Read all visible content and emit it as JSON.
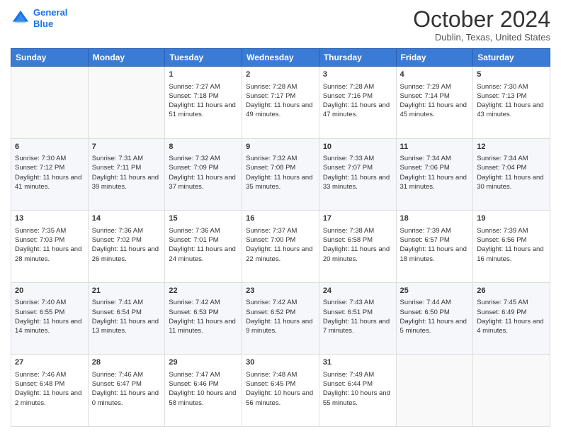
{
  "header": {
    "logo_line1": "General",
    "logo_line2": "Blue",
    "month": "October 2024",
    "location": "Dublin, Texas, United States"
  },
  "days_of_week": [
    "Sunday",
    "Monday",
    "Tuesday",
    "Wednesday",
    "Thursday",
    "Friday",
    "Saturday"
  ],
  "weeks": [
    [
      {
        "day": "",
        "empty": true
      },
      {
        "day": "",
        "empty": true
      },
      {
        "day": "1",
        "sunrise": "Sunrise: 7:27 AM",
        "sunset": "Sunset: 7:18 PM",
        "daylight": "Daylight: 11 hours and 51 minutes."
      },
      {
        "day": "2",
        "sunrise": "Sunrise: 7:28 AM",
        "sunset": "Sunset: 7:17 PM",
        "daylight": "Daylight: 11 hours and 49 minutes."
      },
      {
        "day": "3",
        "sunrise": "Sunrise: 7:28 AM",
        "sunset": "Sunset: 7:16 PM",
        "daylight": "Daylight: 11 hours and 47 minutes."
      },
      {
        "day": "4",
        "sunrise": "Sunrise: 7:29 AM",
        "sunset": "Sunset: 7:14 PM",
        "daylight": "Daylight: 11 hours and 45 minutes."
      },
      {
        "day": "5",
        "sunrise": "Sunrise: 7:30 AM",
        "sunset": "Sunset: 7:13 PM",
        "daylight": "Daylight: 11 hours and 43 minutes."
      }
    ],
    [
      {
        "day": "6",
        "sunrise": "Sunrise: 7:30 AM",
        "sunset": "Sunset: 7:12 PM",
        "daylight": "Daylight: 11 hours and 41 minutes."
      },
      {
        "day": "7",
        "sunrise": "Sunrise: 7:31 AM",
        "sunset": "Sunset: 7:11 PM",
        "daylight": "Daylight: 11 hours and 39 minutes."
      },
      {
        "day": "8",
        "sunrise": "Sunrise: 7:32 AM",
        "sunset": "Sunset: 7:09 PM",
        "daylight": "Daylight: 11 hours and 37 minutes."
      },
      {
        "day": "9",
        "sunrise": "Sunrise: 7:32 AM",
        "sunset": "Sunset: 7:08 PM",
        "daylight": "Daylight: 11 hours and 35 minutes."
      },
      {
        "day": "10",
        "sunrise": "Sunrise: 7:33 AM",
        "sunset": "Sunset: 7:07 PM",
        "daylight": "Daylight: 11 hours and 33 minutes."
      },
      {
        "day": "11",
        "sunrise": "Sunrise: 7:34 AM",
        "sunset": "Sunset: 7:06 PM",
        "daylight": "Daylight: 11 hours and 31 minutes."
      },
      {
        "day": "12",
        "sunrise": "Sunrise: 7:34 AM",
        "sunset": "Sunset: 7:04 PM",
        "daylight": "Daylight: 11 hours and 30 minutes."
      }
    ],
    [
      {
        "day": "13",
        "sunrise": "Sunrise: 7:35 AM",
        "sunset": "Sunset: 7:03 PM",
        "daylight": "Daylight: 11 hours and 28 minutes."
      },
      {
        "day": "14",
        "sunrise": "Sunrise: 7:36 AM",
        "sunset": "Sunset: 7:02 PM",
        "daylight": "Daylight: 11 hours and 26 minutes."
      },
      {
        "day": "15",
        "sunrise": "Sunrise: 7:36 AM",
        "sunset": "Sunset: 7:01 PM",
        "daylight": "Daylight: 11 hours and 24 minutes."
      },
      {
        "day": "16",
        "sunrise": "Sunrise: 7:37 AM",
        "sunset": "Sunset: 7:00 PM",
        "daylight": "Daylight: 11 hours and 22 minutes."
      },
      {
        "day": "17",
        "sunrise": "Sunrise: 7:38 AM",
        "sunset": "Sunset: 6:58 PM",
        "daylight": "Daylight: 11 hours and 20 minutes."
      },
      {
        "day": "18",
        "sunrise": "Sunrise: 7:39 AM",
        "sunset": "Sunset: 6:57 PM",
        "daylight": "Daylight: 11 hours and 18 minutes."
      },
      {
        "day": "19",
        "sunrise": "Sunrise: 7:39 AM",
        "sunset": "Sunset: 6:56 PM",
        "daylight": "Daylight: 11 hours and 16 minutes."
      }
    ],
    [
      {
        "day": "20",
        "sunrise": "Sunrise: 7:40 AM",
        "sunset": "Sunset: 6:55 PM",
        "daylight": "Daylight: 11 hours and 14 minutes."
      },
      {
        "day": "21",
        "sunrise": "Sunrise: 7:41 AM",
        "sunset": "Sunset: 6:54 PM",
        "daylight": "Daylight: 11 hours and 13 minutes."
      },
      {
        "day": "22",
        "sunrise": "Sunrise: 7:42 AM",
        "sunset": "Sunset: 6:53 PM",
        "daylight": "Daylight: 11 hours and 11 minutes."
      },
      {
        "day": "23",
        "sunrise": "Sunrise: 7:42 AM",
        "sunset": "Sunset: 6:52 PM",
        "daylight": "Daylight: 11 hours and 9 minutes."
      },
      {
        "day": "24",
        "sunrise": "Sunrise: 7:43 AM",
        "sunset": "Sunset: 6:51 PM",
        "daylight": "Daylight: 11 hours and 7 minutes."
      },
      {
        "day": "25",
        "sunrise": "Sunrise: 7:44 AM",
        "sunset": "Sunset: 6:50 PM",
        "daylight": "Daylight: 11 hours and 5 minutes."
      },
      {
        "day": "26",
        "sunrise": "Sunrise: 7:45 AM",
        "sunset": "Sunset: 6:49 PM",
        "daylight": "Daylight: 11 hours and 4 minutes."
      }
    ],
    [
      {
        "day": "27",
        "sunrise": "Sunrise: 7:46 AM",
        "sunset": "Sunset: 6:48 PM",
        "daylight": "Daylight: 11 hours and 2 minutes."
      },
      {
        "day": "28",
        "sunrise": "Sunrise: 7:46 AM",
        "sunset": "Sunset: 6:47 PM",
        "daylight": "Daylight: 11 hours and 0 minutes."
      },
      {
        "day": "29",
        "sunrise": "Sunrise: 7:47 AM",
        "sunset": "Sunset: 6:46 PM",
        "daylight": "Daylight: 10 hours and 58 minutes."
      },
      {
        "day": "30",
        "sunrise": "Sunrise: 7:48 AM",
        "sunset": "Sunset: 6:45 PM",
        "daylight": "Daylight: 10 hours and 56 minutes."
      },
      {
        "day": "31",
        "sunrise": "Sunrise: 7:49 AM",
        "sunset": "Sunset: 6:44 PM",
        "daylight": "Daylight: 10 hours and 55 minutes."
      },
      {
        "day": "",
        "empty": true
      },
      {
        "day": "",
        "empty": true
      }
    ]
  ]
}
